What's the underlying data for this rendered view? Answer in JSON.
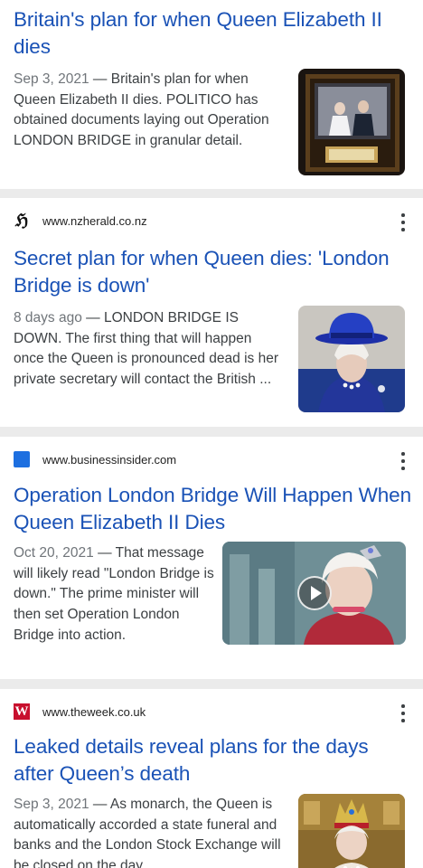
{
  "results": [
    {
      "title": "Britain's plan for when Queen Elizabeth II dies",
      "date": "Sep 3, 2021",
      "snippet": "Britain's plan for when Queen Elizabeth II dies. POLITICO has obtained documents laying out Operation LONDON BRIDGE in granular detail."
    },
    {
      "site": "www.nzherald.co.nz",
      "site_icon": "nzherald-logo-icon",
      "site_icon_glyph": "ℌ",
      "title": "Secret plan for when Queen dies: 'London Bridge is down'",
      "date": "8 days ago",
      "snippet": "LONDON BRIDGE IS DOWN. The first thing that will happen once the Queen is pronounced dead is her private secretary will contact the British ..."
    },
    {
      "site": "www.businessinsider.com",
      "site_icon": "businessinsider-logo-icon",
      "title": "Operation London Bridge Will Happen When Queen Elizabeth II Dies",
      "date": "Oct 20, 2021",
      "snippet": "That message will likely read \"London Bridge is down.\" The prime minister will then set Operation London Bridge into action."
    },
    {
      "site": "www.theweek.co.uk",
      "site_icon": "theweek-logo-icon",
      "site_icon_glyph": "W",
      "title": "Leaked details reveal plans for the days after Queen’s death",
      "date": "Sep 3, 2021",
      "snippet": "As monarch, the Queen is automatically accorded a state funeral and banks and the London Stock Exchange will be closed on the day ..."
    }
  ],
  "separator": " — ",
  "colors": {
    "title_link": "#1a52b6",
    "snippet_text": "#3c4043",
    "date_text": "#70757a",
    "page_background": "#ebebeb",
    "businessinsider_blue": "#1d6fe0",
    "theweek_red": "#c8102e"
  }
}
